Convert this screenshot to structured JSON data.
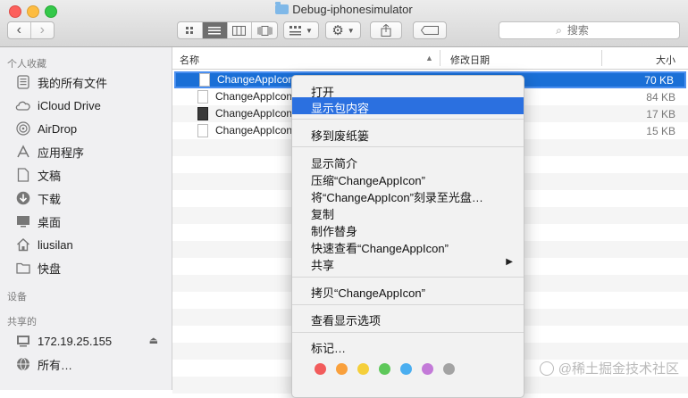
{
  "window": {
    "title": "Debug-iphonesimulator",
    "folder_icon": "folder-icon"
  },
  "toolbar": {
    "back_icon": "‹",
    "forward_icon": "›",
    "search_placeholder": "搜索",
    "colors": {
      "active_view": "#6e6e6e"
    }
  },
  "sidebar": {
    "favorites_header": "个人收藏",
    "favorites": [
      {
        "label": "我的所有文件",
        "icon": "all-files-icon"
      },
      {
        "label": "iCloud Drive",
        "icon": "cloud-icon"
      },
      {
        "label": "AirDrop",
        "icon": "airdrop-icon"
      },
      {
        "label": "应用程序",
        "icon": "applications-icon"
      },
      {
        "label": "文稿",
        "icon": "documents-icon"
      },
      {
        "label": "下载",
        "icon": "download-icon"
      },
      {
        "label": "桌面",
        "icon": "desktop-icon"
      },
      {
        "label": "liusilan",
        "icon": "home-icon"
      },
      {
        "label": "快盘",
        "icon": "folder-icon"
      }
    ],
    "devices_header": "设备",
    "shared_header": "共享的",
    "shared": [
      {
        "label": "172.19.25.155",
        "icon": "server-icon"
      },
      {
        "label": "所有…",
        "icon": "network-icon"
      }
    ]
  },
  "file_list": {
    "columns": {
      "name": "名称",
      "modified": "修改日期",
      "size": "大小"
    },
    "files": [
      {
        "name": "ChangeAppIcon",
        "size": "70 KB",
        "selected": true
      },
      {
        "name": "ChangeAppIcon",
        "size": "84 KB"
      },
      {
        "name": "ChangeAppIcon",
        "size": "17 KB"
      },
      {
        "name": "ChangeAppIcon",
        "size": "15 KB"
      }
    ]
  },
  "context_menu": {
    "items": [
      "打开",
      "显示包内容",
      "移到废纸篓",
      "显示简介",
      "压缩“ChangeAppIcon”",
      "将“ChangeAppIcon”刻录至光盘…",
      "复制",
      "制作替身",
      "快速查看“ChangeAppIcon”",
      "共享",
      "拷贝“ChangeAppIcon”",
      "查看显示选项",
      "标记…"
    ],
    "highlighted": "显示包内容",
    "submenu_arrow": "▶",
    "tag_colors": [
      "#f25c5c",
      "#f9a03c",
      "#f5cf3a",
      "#5ec85a",
      "#4aaef0",
      "#c37ad8",
      "#a3a3a3"
    ]
  },
  "watermark": "@稀土掘金技术社区"
}
